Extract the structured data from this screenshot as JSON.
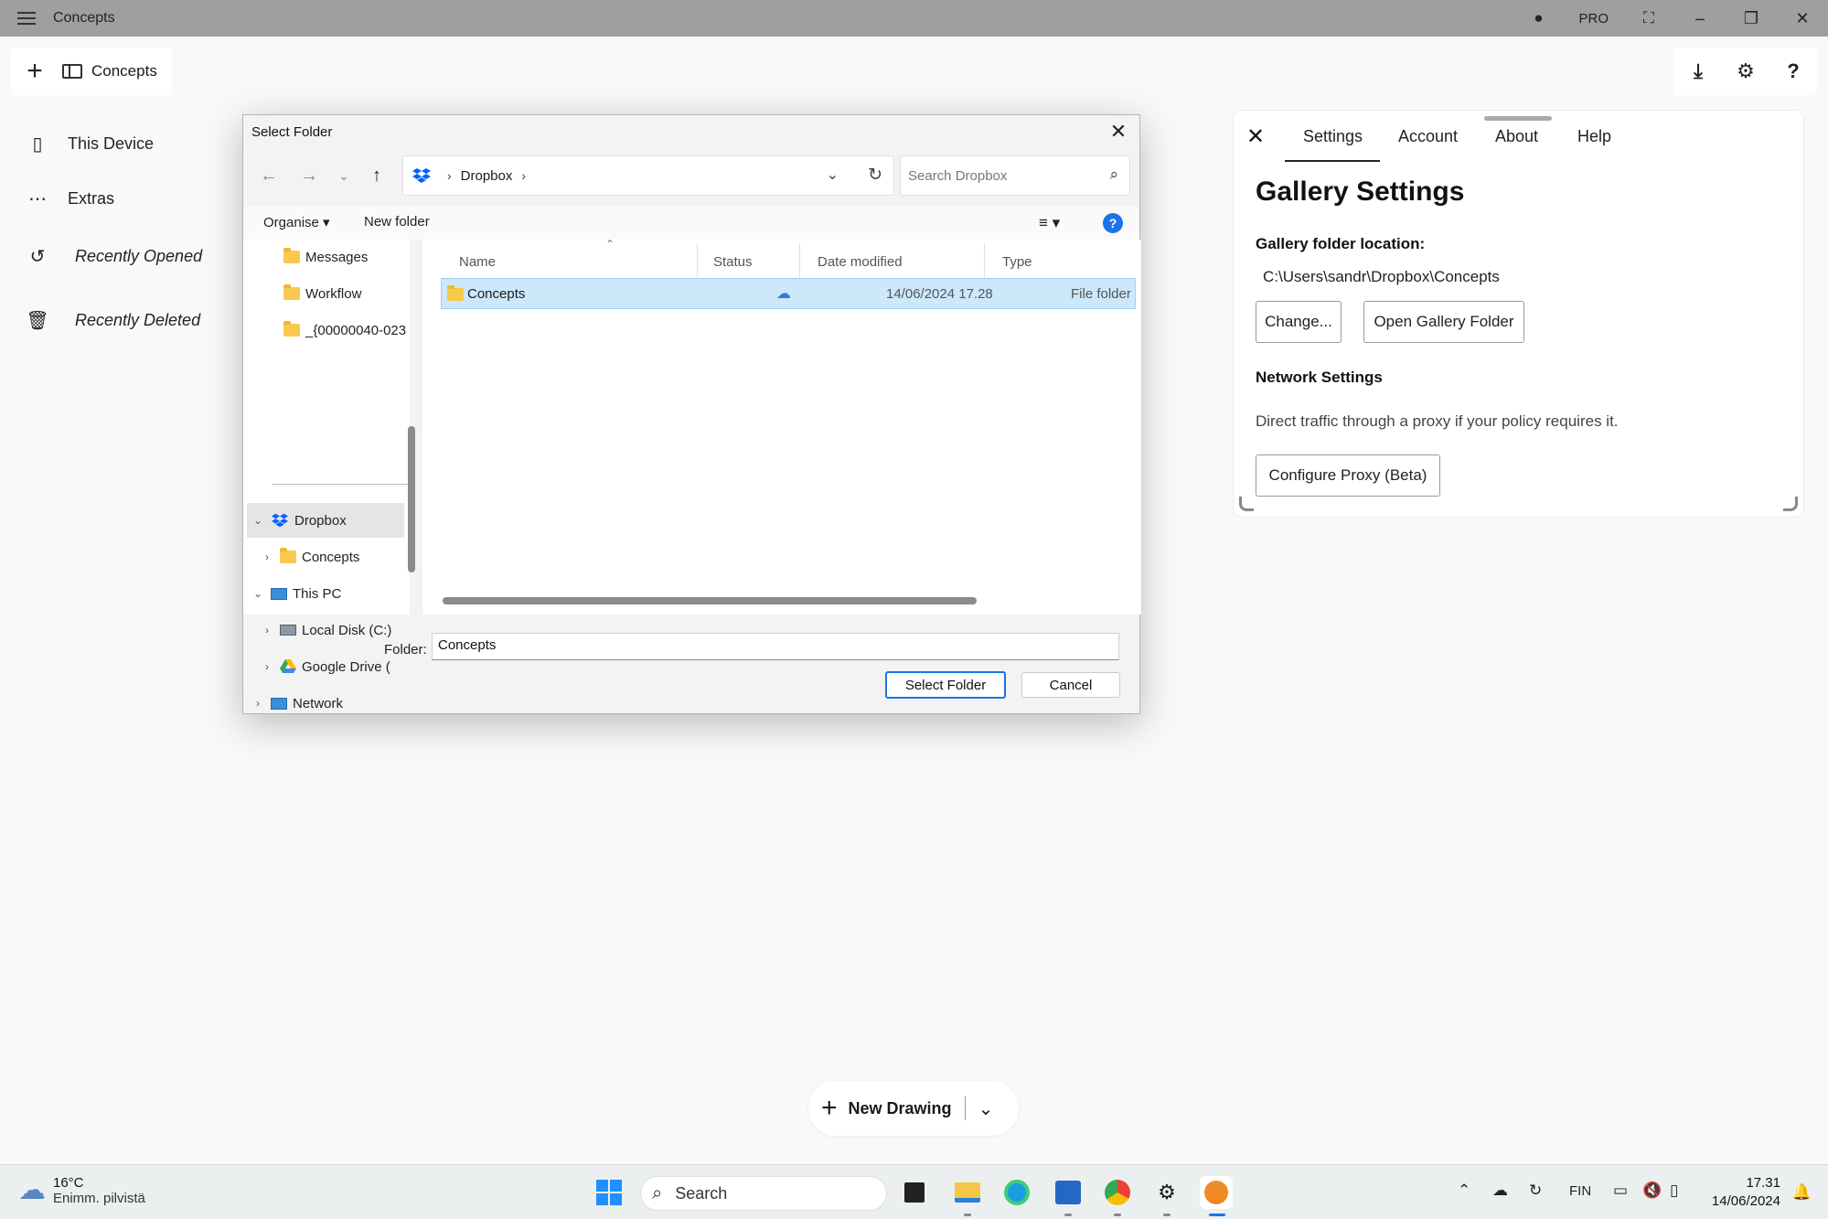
{
  "titlebar": {
    "app_name": "Concepts",
    "pro_label": "PRO"
  },
  "toolbar": {
    "tab_label": "Concepts"
  },
  "sidebar": {
    "items": [
      {
        "label": "This Device",
        "icon": "device-icon"
      },
      {
        "label": "Extras",
        "icon": "more-icon"
      },
      {
        "label": "Recently Opened",
        "icon": "history-icon"
      },
      {
        "label": "Recently Deleted",
        "icon": "trash-icon"
      }
    ]
  },
  "dialog": {
    "title": "Select Folder",
    "breadcrumb": [
      "Dropbox"
    ],
    "search_placeholder": "Search Dropbox",
    "organise": "Organise",
    "new_folder": "New folder",
    "tree": [
      {
        "label": "Messages"
      },
      {
        "label": "Workflow"
      },
      {
        "label": "_{00000040-023"
      },
      {
        "label": "Dropbox"
      },
      {
        "label": "Concepts"
      },
      {
        "label": "This PC"
      },
      {
        "label": "Local Disk (C:)"
      },
      {
        "label": "Google Drive ("
      },
      {
        "label": "Network"
      }
    ],
    "columns": [
      "Name",
      "Status",
      "Date modified",
      "Type"
    ],
    "rows": [
      {
        "name": "Concepts",
        "status": "cloud",
        "date": "14/06/2024 17.28",
        "type": "File folder"
      }
    ],
    "folder_label": "Folder:",
    "folder_value": "Concepts",
    "select_button": "Select Folder",
    "cancel_button": "Cancel"
  },
  "settings": {
    "tabs": [
      "Settings",
      "Account",
      "About",
      "Help"
    ],
    "active_tab": "Settings",
    "heading": "Gallery Settings",
    "gallery_location_label": "Gallery folder location:",
    "gallery_path": "C:\\Users\\sandr\\Dropbox\\Concepts",
    "change_button": "Change...",
    "open_folder_button": "Open Gallery Folder",
    "network_heading": "Network Settings",
    "network_desc": "Direct traffic through a proxy if your policy requires it.",
    "proxy_button": "Configure Proxy  (Beta)"
  },
  "new_drawing": {
    "label": "New Drawing"
  },
  "taskbar": {
    "temperature": "16°C",
    "weather_desc": "Enimm. pilvistä",
    "search_label": "Search",
    "language": "FIN",
    "time": "17.31",
    "date": "14/06/2024"
  }
}
